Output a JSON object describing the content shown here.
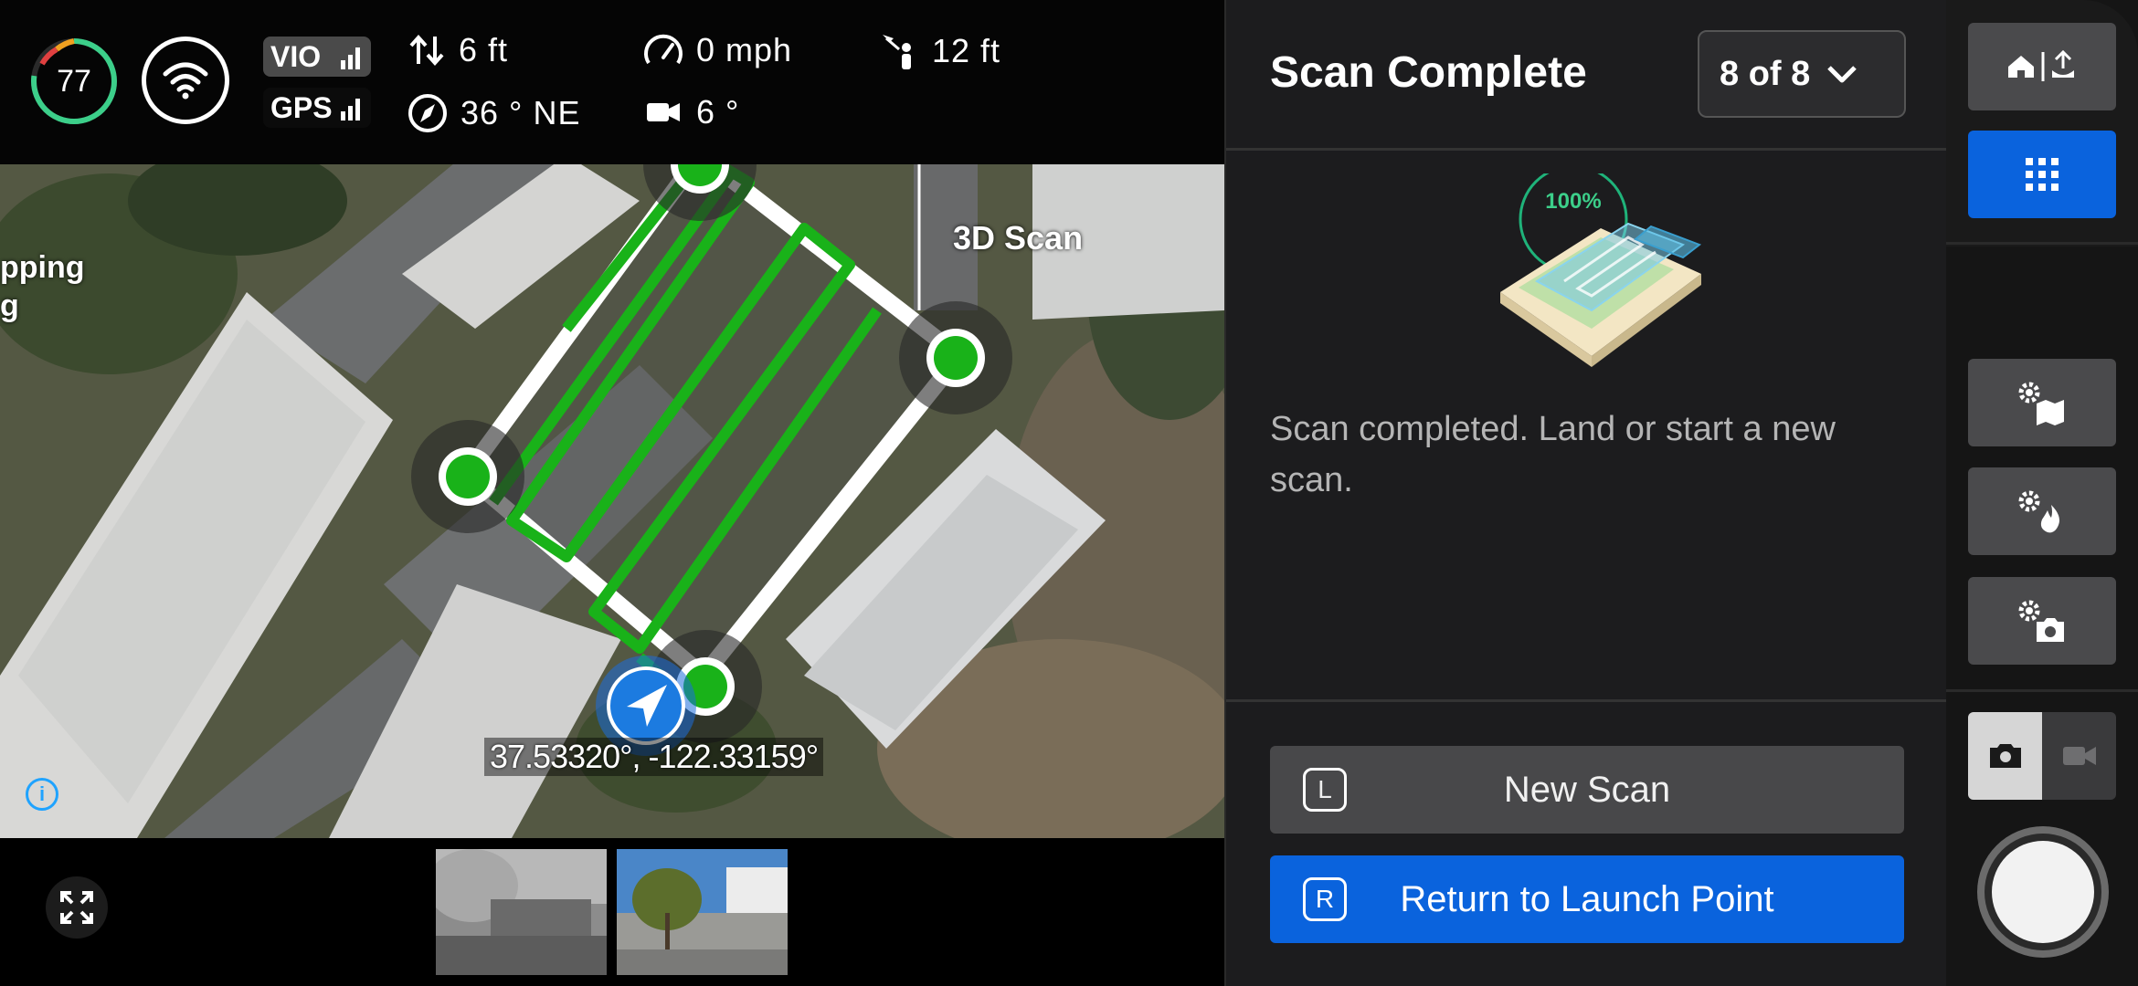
{
  "telemetry": {
    "battery_percent": "77",
    "battery_level_fraction": 0.77,
    "nav_vio_label": "VIO",
    "nav_gps_label": "GPS",
    "vertical_speed": "6 ft",
    "heading": "36 ° NE",
    "speed": "0 mph",
    "camera_tilt": "6 °",
    "distance_from_pilot": "12 ft"
  },
  "map": {
    "overlay_label": "3D Scan",
    "side_label_line1": "pping",
    "side_label_line2": "g",
    "coordinates": "37.53320°, -122.33159°",
    "info_icon": "info-icon"
  },
  "panel": {
    "title": "Scan Complete",
    "scan_selector": "8 of 8",
    "progress_label": "100%",
    "message": "Scan completed. Land or start a new scan.",
    "new_scan_key": "L",
    "new_scan_label": "New Scan",
    "rtl_key": "R",
    "rtl_label": "Return to Launch Point"
  },
  "controls": {
    "icons": [
      "home-launch-icon",
      "grid-icon",
      "map-settings-icon",
      "fire-settings-icon",
      "camera-settings-icon",
      "photo-icon",
      "video-icon"
    ],
    "active_mode": "photo"
  },
  "colors": {
    "accent_blue": "#0a63dd",
    "scan_green": "#19b219",
    "battery_green": "#3ccf8a"
  }
}
